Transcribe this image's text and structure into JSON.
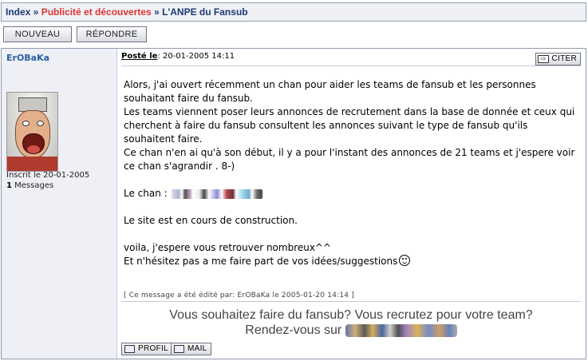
{
  "breadcrumb": {
    "index": "Index",
    "sep1": " » ",
    "category": "Publicité et découvertes",
    "sep2": " » ",
    "topic": "L'ANPE du Fansub"
  },
  "buttons": {
    "new_topic": "NOUVEAU",
    "reply": "RÉPONDRE"
  },
  "post": {
    "author": "ErOBaKa",
    "joined": "Inscrit le 20-01-2005",
    "message_count": "1",
    "messages_label": " Messages",
    "posted_label": "Posté le",
    "posted_date": ": 20-01-2005 14:11",
    "quote_label": "CITER",
    "body": {
      "p1": "Alors, j'ai ouvert récemment un chan pour aider les teams de fansub et les personnes souhaitant faire du fansub.",
      "p2": "Les teams viennent poser leurs annonces de recrutement dans la base de donnée et ceux qui cherchent à faire du fansub consultent les annonces suivant le type de fansub qu'ils souhaitent faire.",
      "p3": "Ce chan n'en ai qu'à son début, il y a pour l'instant des annonces de 21 teams et j'espere voir ce chan s'agrandir . 8-)",
      "chan_label": "Le chan : ",
      "construction": "Le site est en cours de construction.",
      "p5": "voila, j'espere vous retrouver nombreux^^",
      "p6": "Et n'hésitez pas a me faire part de vos idées/suggestions"
    },
    "edited_note": "[ Ce message a été édité par: ErOBaKa le 2005-01-20 14:14 ]",
    "signature_line1": "Vous souhaitez faire du fansub? Vous recrutez pour votre team?",
    "signature_line2": "Rendez-vous sur ",
    "profile_label": "PROFIL",
    "mail_label": "MAIL"
  }
}
